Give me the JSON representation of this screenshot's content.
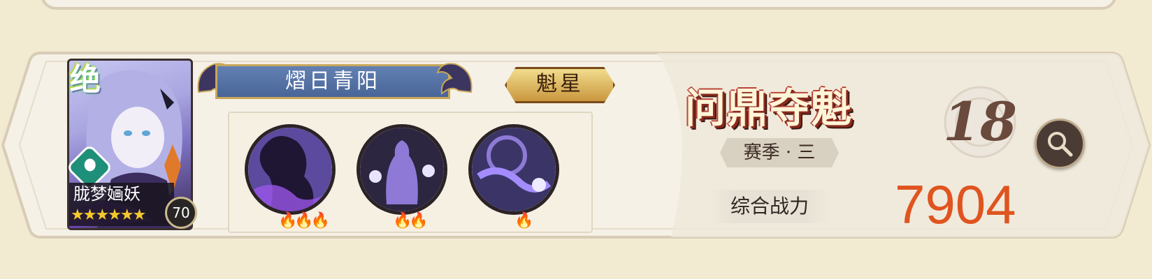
{
  "character": {
    "rank_glyph": "绝",
    "name": "胧梦婳妖",
    "stars": "★★★★★★",
    "level": "70"
  },
  "team": {
    "name": "熠日青阳",
    "rank_badge": "魁星"
  },
  "skills": [
    {
      "icon": "shadow-figure-skill-icon",
      "flames": "🔥🔥🔥"
    },
    {
      "icon": "spirit-woman-skill-icon",
      "flames": "🔥🔥"
    },
    {
      "icon": "spirit-wave-skill-icon",
      "flames": "🔥"
    }
  ],
  "event": {
    "title": "问鼎夺魁",
    "season": "赛季 · 三",
    "rank": "18",
    "power_label": "综合战力",
    "power_value": "7904"
  },
  "colors": {
    "background": "#f3ead2",
    "card": "#f6f1e6",
    "accent_orange": "#e0541f",
    "banner_blue": "#496597"
  }
}
